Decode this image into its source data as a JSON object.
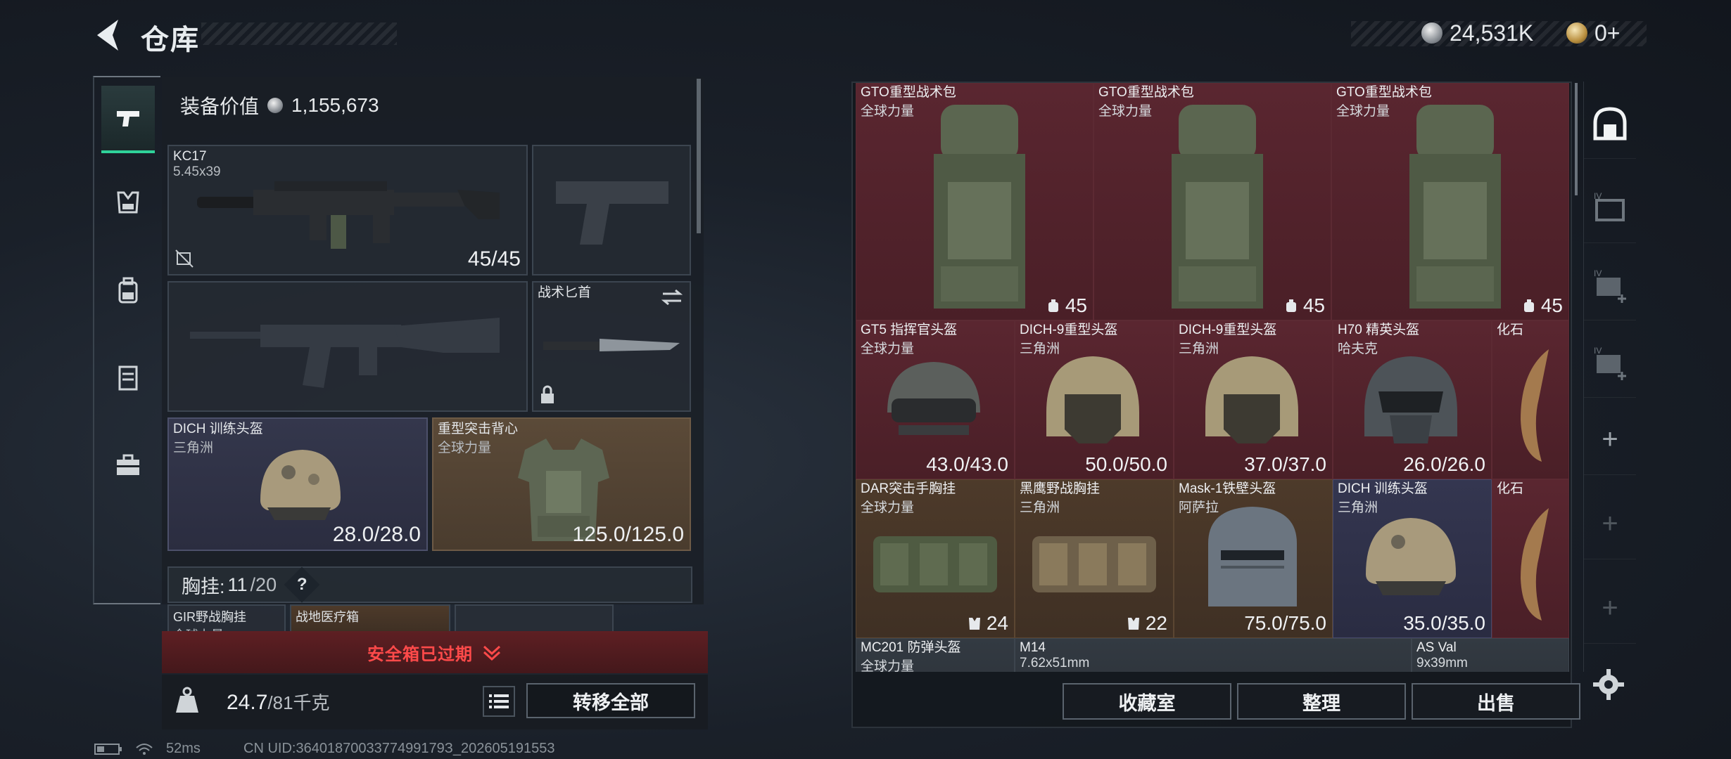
{
  "header": {
    "title": "仓库",
    "currency_a": "24,531K",
    "currency_b": "0+"
  },
  "left_nav": {
    "items": [
      "weapon",
      "vest",
      "backpack",
      "armor",
      "case"
    ]
  },
  "equipment": {
    "value_label": "装备价值",
    "value": "1,155,673",
    "primary": {
      "name": "KC17",
      "caliber": "5.45x39",
      "ammo": "45/45"
    },
    "melee": {
      "name": "战术匕首"
    },
    "helmet": {
      "name": "DICH 训练头盔",
      "sub": "三角洲",
      "durability": "28.0/28.0"
    },
    "armor": {
      "name": "重型突击背心",
      "sub": "全球力量",
      "durability": "125.0/125.0"
    },
    "vest_label": "胸挂:",
    "vest_capacity": "11",
    "vest_total": "/20",
    "vest_help": "?",
    "vest_items": [
      {
        "name": "GIR野战胸挂",
        "sub": "全球力量"
      },
      {
        "name": "战地医疗箱"
      }
    ],
    "safe_box_expired": "安全箱已过期",
    "weight_value": "24.7",
    "weight_total": "/81千克",
    "transfer_all": "转移全部"
  },
  "storage": {
    "row1": [
      {
        "name": "GTO重型战术包",
        "sub": "全球力量",
        "val": "45"
      },
      {
        "name": "GTO重型战术包",
        "sub": "全球力量",
        "val": "45"
      },
      {
        "name": "GTO重型战术包",
        "sub": "全球力量",
        "val": "45"
      }
    ],
    "row2": [
      {
        "name": "GT5 指挥官头盔",
        "sub": "全球力量",
        "val": "43.0/43.0"
      },
      {
        "name": "DICH-9重型头盔",
        "sub": "三角洲",
        "val": "50.0/50.0"
      },
      {
        "name": "DICH-9重型头盔",
        "sub": "三角洲",
        "val": "37.0/37.0"
      },
      {
        "name": "H70 精英头盔",
        "sub": "哈夫克",
        "val": "26.0/26.0"
      },
      {
        "name": "化石"
      }
    ],
    "row3": [
      {
        "name": "DAR突击手胸挂",
        "sub": "全球力量",
        "val": "24"
      },
      {
        "name": "黑鹰野战胸挂",
        "sub": "三角洲",
        "val": "22"
      },
      {
        "name": "Mask-1铁壁头盔",
        "sub": "阿萨拉",
        "val": "75.0/75.0"
      },
      {
        "name": "DICH 训练头盔",
        "sub": "三角洲",
        "val": "35.0/35.0"
      },
      {
        "name": "化石"
      }
    ],
    "row4": [
      {
        "name": "MC201 防弹头盔",
        "sub": "全球力量"
      },
      {
        "name": "M14",
        "sub": "7.62x51mm"
      },
      {
        "name": "AS Val",
        "sub": "9x39mm"
      }
    ]
  },
  "actions": {
    "collection": "收藏室",
    "organize": "整理",
    "sell": "出售"
  },
  "status": {
    "ping": "52ms",
    "uid": "CN UID:3640187003377499179З_202605191553"
  },
  "colors": {
    "accent_green": "#2fd29a",
    "expired_red": "#ff4a4a",
    "storage_red": "#5a2630"
  }
}
